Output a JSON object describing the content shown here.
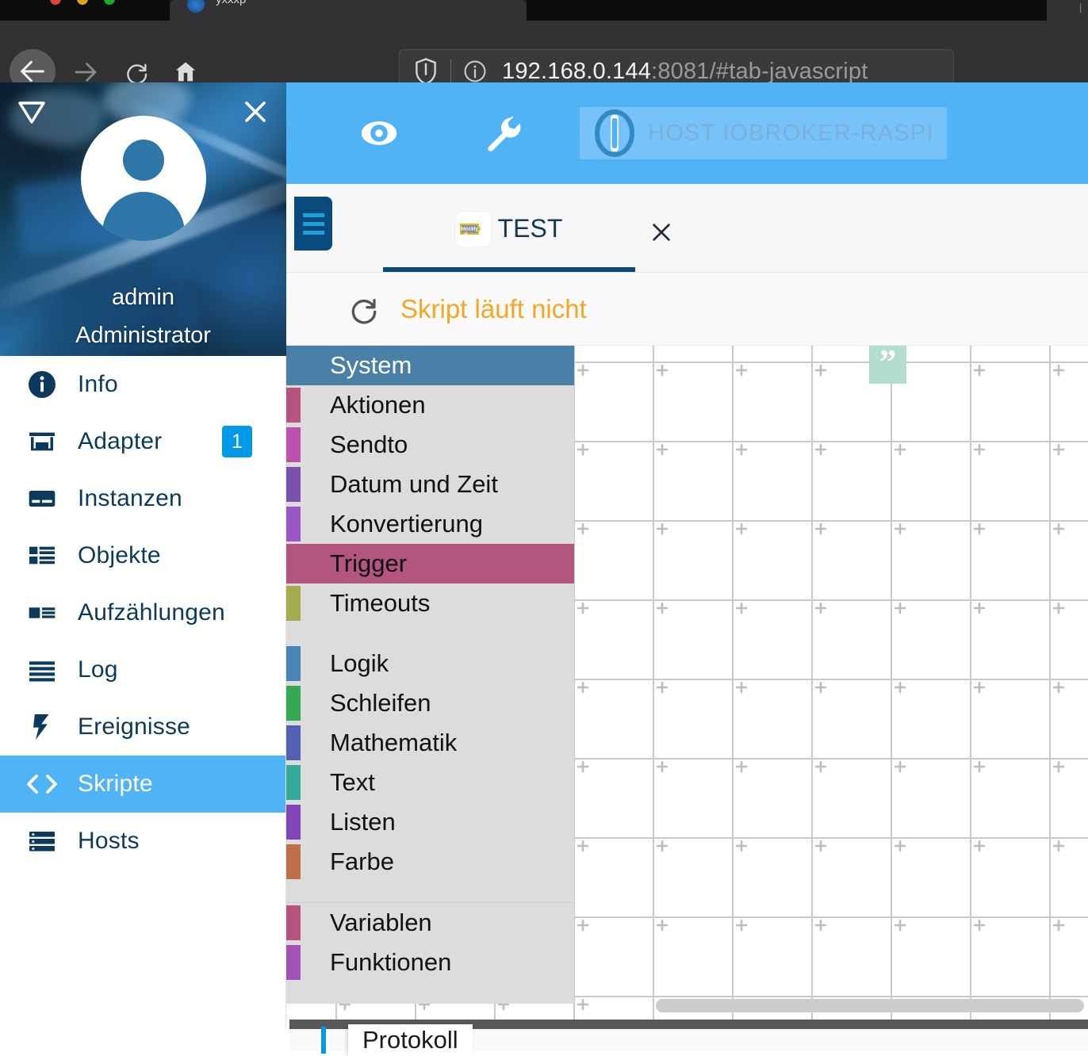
{
  "browser": {
    "back_icon": "arrow-left-icon",
    "forward_icon": "arrow-right-icon",
    "reload_icon": "reload-icon",
    "home_icon": "home-icon",
    "shield_icon": "shield-icon",
    "info_icon": "info-circle-icon",
    "url_host": "192.168.0.144",
    "url_rest": ":8081/#tab-javascript",
    "tab_title_partial": "yxxxp",
    "tab_overflow_sep": "|"
  },
  "sidebar": {
    "collapse_icon": "triangle-down-icon",
    "close_icon": "close-icon",
    "avatar_icon": "user-avatar-icon",
    "user_name": "admin",
    "user_role": "Administrator",
    "items": [
      {
        "label": "Info",
        "icon": "info-icon",
        "active": false,
        "badge": null
      },
      {
        "label": "Adapter",
        "icon": "store-icon",
        "active": false,
        "badge": "1"
      },
      {
        "label": "Instanzen",
        "icon": "instances-icon",
        "active": false,
        "badge": null
      },
      {
        "label": "Objekte",
        "icon": "objects-grid-icon",
        "active": false,
        "badge": null
      },
      {
        "label": "Aufzählungen",
        "icon": "enums-icon",
        "active": false,
        "badge": null
      },
      {
        "label": "Log",
        "icon": "log-lines-icon",
        "active": false,
        "badge": null
      },
      {
        "label": "Ereignisse",
        "icon": "lightning-icon",
        "active": false,
        "badge": null
      },
      {
        "label": "Skripte",
        "icon": "code-brackets-icon",
        "active": true,
        "badge": null
      },
      {
        "label": "Hosts",
        "icon": "server-icon",
        "active": false,
        "badge": null
      }
    ]
  },
  "topbar": {
    "eye_icon": "eye-icon",
    "wrench_icon": "wrench-icon",
    "host_logo_icon": "iobroker-logo-icon",
    "host_label": "HOST IOBROKER-RASPI",
    "accent_color": "#4fb3f6"
  },
  "tabbar": {
    "menu_icon": "hamburger-menu-icon",
    "script_tab_icon": "blockly-icon",
    "script_tab_label": "TEST",
    "close_icon": "close-icon"
  },
  "status": {
    "refresh_icon": "refresh-icon",
    "text": "Skript läuft nicht",
    "color": "#f5a623"
  },
  "toolbox": {
    "groups": [
      {
        "rows": [
          {
            "label": "System",
            "color": "#4a7fa8",
            "state": "selected"
          },
          {
            "label": "Aktionen",
            "color": "#b5547e",
            "state": "normal"
          },
          {
            "label": "Sendto",
            "color": "#bb52ac",
            "state": "normal"
          },
          {
            "label": "Datum und Zeit",
            "color": "#7b52ab",
            "state": "normal"
          },
          {
            "label": "Konvertierung",
            "color": "#9b55c4",
            "state": "normal"
          },
          {
            "label": "Trigger",
            "color": "#b25580",
            "state": "highlighted"
          },
          {
            "label": "Timeouts",
            "color": "#a3ad4d",
            "state": "normal"
          }
        ]
      },
      {
        "rows": [
          {
            "label": "Logik",
            "color": "#4a84b4",
            "state": "normal"
          },
          {
            "label": "Schleifen",
            "color": "#34a852",
            "state": "normal"
          },
          {
            "label": "Mathematik",
            "color": "#5261b0",
            "state": "normal"
          },
          {
            "label": "Text",
            "color": "#33ab9b",
            "state": "normal"
          },
          {
            "label": "Listen",
            "color": "#8046b8",
            "state": "normal"
          },
          {
            "label": "Farbe",
            "color": "#bd7049",
            "state": "normal"
          }
        ]
      },
      {
        "rows": [
          {
            "label": "Variablen",
            "color": "#b5547e",
            "state": "normal"
          },
          {
            "label": "Funktionen",
            "color": "#a352b8",
            "state": "normal"
          }
        ]
      }
    ]
  },
  "workspace": {
    "comment_block_glyph": "”",
    "comment_block_color": "#b4ddd1",
    "scrollbar_icon": "horizontal-scrollbar"
  },
  "footer": {
    "protokoll_label": "Protokoll",
    "accent_color": "#029ae8"
  }
}
